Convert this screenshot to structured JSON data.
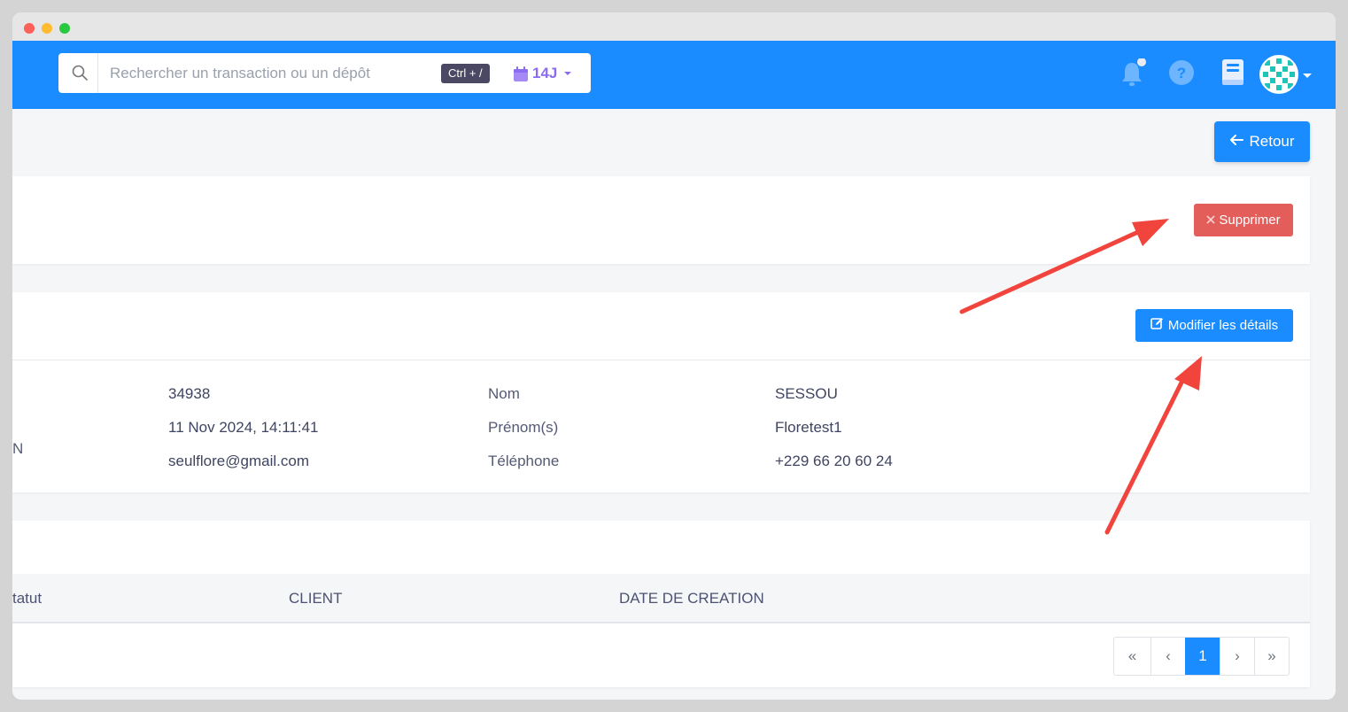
{
  "navbar": {
    "search_placeholder": "Rechercher un transaction ou un dépôt",
    "search_shortcut": "Ctrl + /",
    "period_label": "14J"
  },
  "actions": {
    "back_label": "Retour",
    "delete_label": "Supprimer",
    "edit_label": "Modifier les détails"
  },
  "details": {
    "left": [
      {
        "label_fragment": "",
        "value": "34938"
      },
      {
        "label_fragment": "N",
        "value": "11 Nov 2024, 14:11:41"
      },
      {
        "label_fragment": "",
        "value": "seulflore@gmail.com"
      }
    ],
    "right": [
      {
        "label": "Nom",
        "value": "SESSOU"
      },
      {
        "label": "Prénom(s)",
        "value": "Floretest1"
      },
      {
        "label": "Téléphone",
        "value": "+229 66 20 60 24"
      }
    ]
  },
  "table": {
    "columns": [
      "tatut",
      "CLIENT",
      "DATE DE CREATION"
    ]
  },
  "pagination": [
    "«",
    "‹",
    "1",
    "›",
    "»"
  ],
  "colors": {
    "primary": "#1a8cff",
    "danger": "#e35d5b",
    "annotation_arrow": "#f1443c"
  }
}
